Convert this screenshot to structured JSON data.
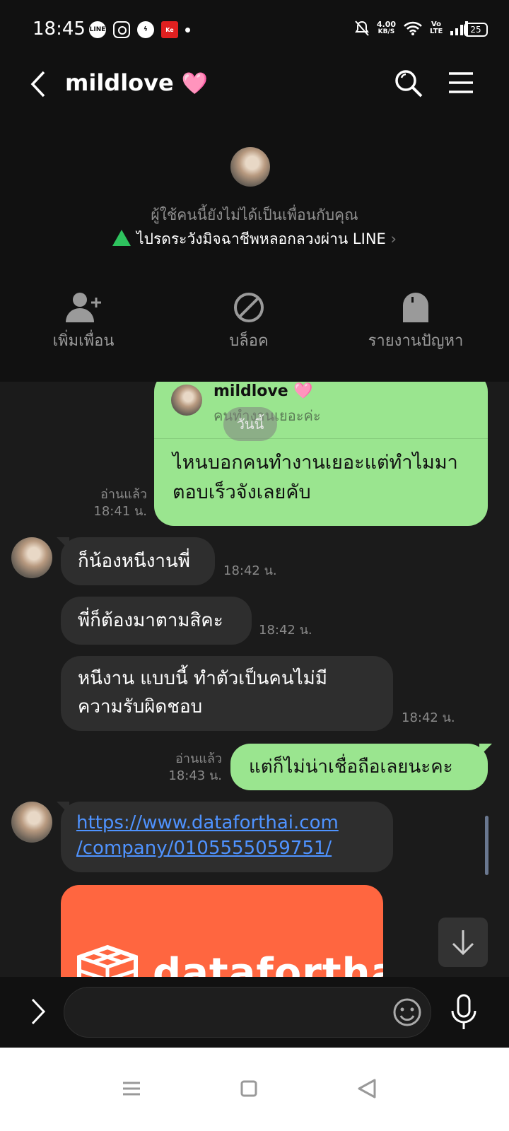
{
  "status_bar": {
    "time": "18:45",
    "net_speed_value": "4.00",
    "net_speed_unit": "KB/S",
    "volte": "Vo LTE",
    "battery": "25",
    "app_icons": [
      "line-icon",
      "instagram-icon",
      "messenger-icon",
      "kerry-icon"
    ]
  },
  "header": {
    "title": "mildlove",
    "title_emoji": "🩷"
  },
  "profile": {
    "not_friend_text": "ผู้ใช้คนนี้ยังไม่ได้เป็นเพื่อนกับคุณ",
    "warning_text": "ไปรดระวังมิจฉาชีพหลอกลวงผ่าน LINE",
    "warning_chevron": "›",
    "actions": [
      {
        "label": "เพิ่มเพื่อน",
        "icon": "add-friend-icon"
      },
      {
        "label": "บล็อค",
        "icon": "block-icon"
      },
      {
        "label": "รายงานปัญหา",
        "icon": "report-icon"
      }
    ]
  },
  "chat": {
    "date_chip": "วันนี้",
    "reply_card": {
      "quoted_name": "mildlove 🩷",
      "quoted_text": "คนทำงานเยอะค่ะ",
      "message_line1": "ไหนบอกคนทำงานเยอะแต่ทำไมมา",
      "message_line2": "ตอบเร็วจังเลยคับ",
      "read": "อ่านแล้ว",
      "time": "18:41 น."
    },
    "messages": [
      {
        "text": "ก็น้องหนีงานพี่",
        "time": "18:42 น."
      },
      {
        "text": "พี่ก็ต้องมาตามสิคะ",
        "time": "18:42 น."
      },
      {
        "line1": "หนีงาน แบบนี้ ทำตัวเป็นคนไม่มี",
        "line2": "ความรับผิดชอบ",
        "time": "18:42 น."
      },
      {
        "text": "แต่ก็ไม่น่าเชื่อถือเลยนะคะ",
        "read": "อ่านแล้ว",
        "time": "18:43 น."
      },
      {
        "link_line1": "https://www.dataforthai.com",
        "link_line2": "/company/0105555059751/"
      }
    ],
    "link_preview": {
      "brand_text": "dataforthai",
      "bg_color": "#ff6640"
    }
  },
  "input": {
    "placeholder": ""
  },
  "colors": {
    "outgoing_bubble": "#9ae58f",
    "incoming_bubble": "#2e2e2e",
    "link": "#4f93ff",
    "warning_green": "#2ec35e"
  }
}
